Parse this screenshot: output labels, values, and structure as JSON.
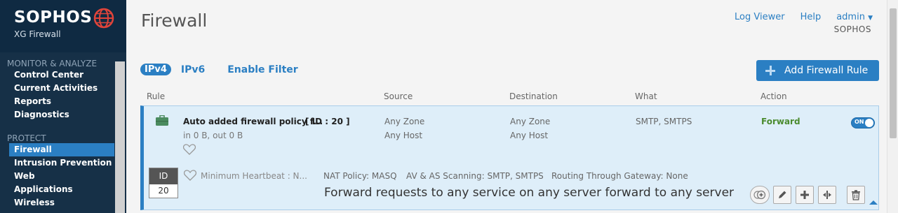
{
  "brand": {
    "name": "SOPHOS",
    "product": "XG Firewall"
  },
  "sidebar": {
    "sections": [
      {
        "label": "MONITOR & ANALYZE",
        "items": [
          "Control Center",
          "Current Activities",
          "Reports",
          "Diagnostics"
        ]
      },
      {
        "label": "PROTECT",
        "items": [
          "Firewall",
          "Intrusion Prevention",
          "Web",
          "Applications",
          "Wireless"
        ]
      }
    ],
    "active_item": "Firewall"
  },
  "header": {
    "title": "Firewall",
    "links": {
      "log_viewer": "Log Viewer",
      "help": "Help",
      "user": "admin"
    },
    "org": "SOPHOS"
  },
  "tabs": {
    "ipv4": "IPv4",
    "ipv6": "IPv6",
    "filter": "Enable Filter"
  },
  "add_button": {
    "label": "Add Firewall Rule"
  },
  "columns": {
    "rule": "Rule",
    "source": "Source",
    "destination": "Destination",
    "what": "What",
    "action": "Action"
  },
  "rule": {
    "name": "Auto added firewall policy f...",
    "id_text": "[ ID : 20 ]",
    "stats": "in 0 B, out 0 B",
    "source_zone": "Any Zone",
    "source_host": "Any Host",
    "dest_zone": "Any Zone",
    "dest_host": "Any Host",
    "what": "SMTP, SMTPS",
    "action": "Forward",
    "toggle": "ON",
    "id_label": "ID",
    "id_value": "20",
    "heartbeat": "Minimum Heartbeat : N...",
    "nat": "NAT Policy: MASQ",
    "av": "AV & AS Scanning: SMTP, SMTPS",
    "routing": "Routing Through Gateway: None",
    "description": "Forward requests to any service on any server forward to any server"
  },
  "colors": {
    "accent": "#2b7fc3",
    "sidebar": "#163047",
    "forward": "#4b8b2f"
  }
}
